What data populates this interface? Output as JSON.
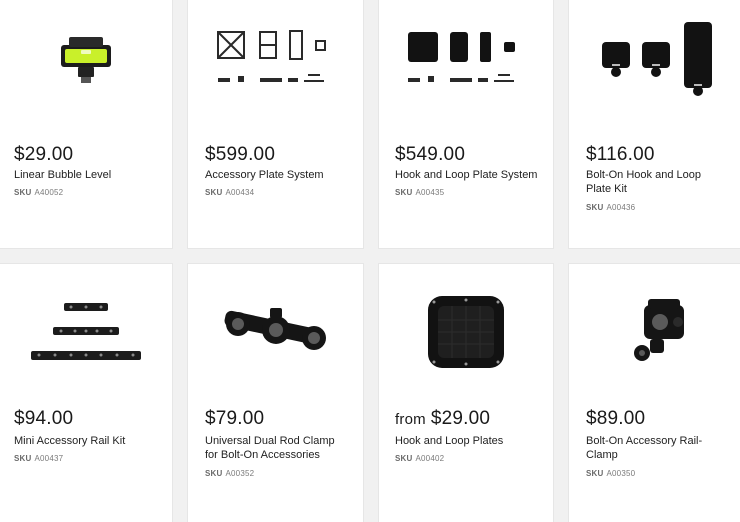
{
  "products": [
    {
      "price": "$29.00",
      "name": "Linear Bubble Level",
      "sku_label": "SKU",
      "sku": "A40052",
      "image": "bubble-level-icon"
    },
    {
      "price": "$599.00",
      "name": "Accessory Plate System",
      "sku_label": "SKU",
      "sku": "A00434",
      "image": "plate-system-icon"
    },
    {
      "price": "$549.00",
      "name": "Hook and Loop Plate System",
      "sku_label": "SKU",
      "sku": "A00435",
      "image": "hook-loop-system-icon"
    },
    {
      "price": "$116.00",
      "name": "Bolt-On Hook and Loop Plate Kit",
      "sku_label": "SKU",
      "sku": "A00436",
      "image": "bolt-on-plate-kit-icon"
    },
    {
      "price": "$94.00",
      "name": "Mini Accessory Rail Kit",
      "sku_label": "SKU",
      "sku": "A00437",
      "image": "rail-kit-icon"
    },
    {
      "price": "$79.00",
      "name": "Universal Dual Rod Clamp for Bolt-On Accessories",
      "sku_label": "SKU",
      "sku": "A00352",
      "image": "rod-clamp-icon"
    },
    {
      "price_prefix": "from",
      "price": "$29.00",
      "name": "Hook and Loop Plates",
      "sku_label": "SKU",
      "sku": "A00402",
      "image": "hook-loop-plate-icon"
    },
    {
      "price": "$89.00",
      "name": "Bolt-On Accessory Rail-Clamp",
      "sku_label": "SKU",
      "sku": "A00350",
      "image": "rail-clamp-icon"
    }
  ],
  "colors": {
    "background": "#f1f1f1",
    "card": "#ffffff",
    "text": "#1a1a1a",
    "sku": "#7a7a7a",
    "level_green": "#c9f02a"
  }
}
